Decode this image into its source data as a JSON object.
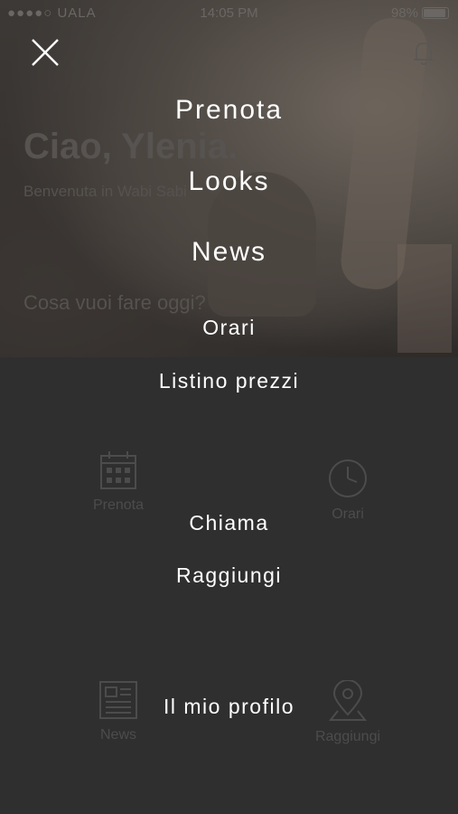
{
  "status_bar": {
    "carrier": "●●●●○ UALA",
    "time": "14:05 PM",
    "battery": "98%"
  },
  "home": {
    "greeting": "Ciao, Ylenia.",
    "subtitle": "Benvenuta in Wabi Sabi",
    "question": "Cosa vuoi fare oggi?",
    "tiles": [
      {
        "label": "Prenota",
        "icon": "calendar-icon"
      },
      {
        "label": "Orari",
        "icon": "clock-icon"
      },
      {
        "label": "News",
        "icon": "newspaper-icon"
      },
      {
        "label": "Raggiungi",
        "icon": "map-pin-icon"
      }
    ]
  },
  "menu": {
    "close_icon": "close-icon",
    "items": [
      {
        "label": "Prenota"
      },
      {
        "label": "Looks"
      },
      {
        "label": "News"
      },
      {
        "label": "Orari"
      },
      {
        "label": "Listino prezzi"
      },
      {
        "label": "Chiama"
      },
      {
        "label": "Raggiungi"
      },
      {
        "label": "Il mio profilo"
      }
    ]
  }
}
